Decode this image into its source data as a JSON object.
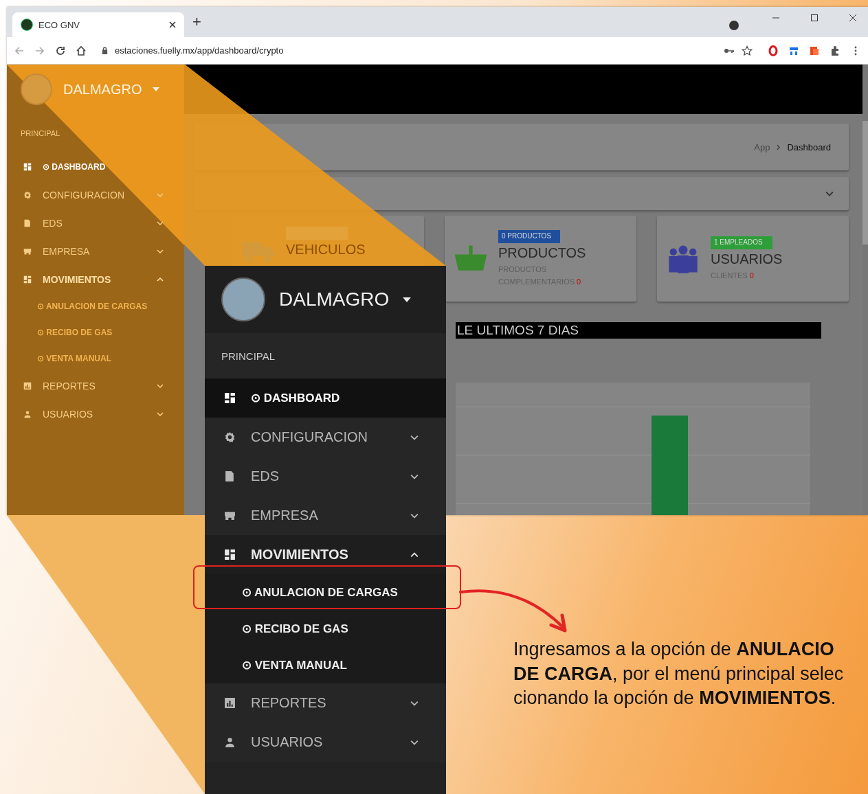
{
  "browser": {
    "tab_title": "ECO GNV",
    "new_tab": "+",
    "url": "estaciones.fuelly.mx/app/dashboard/crypto"
  },
  "background_sidebar": {
    "user": "DALMAGRO",
    "section": "PRINCIPAL",
    "items": [
      {
        "kind": "link",
        "prefix": "⊙",
        "label": "DASHBOARD",
        "selected": true
      },
      {
        "kind": "group",
        "label": "CONFIGURACION",
        "selected": false,
        "expanded": false
      },
      {
        "kind": "group",
        "label": "EDS",
        "selected": false,
        "expanded": false
      },
      {
        "kind": "group",
        "label": "EMPRESA",
        "selected": false,
        "expanded": false
      },
      {
        "kind": "group",
        "label": "MOVIMIENTOS",
        "selected": false,
        "expanded": true,
        "children": [
          {
            "prefix": "⊙",
            "label": "ANULACION DE CARGAS"
          },
          {
            "prefix": "⊙",
            "label": "RECIBO DE GAS"
          },
          {
            "prefix": "⊙",
            "label": "VENTA MANUAL"
          }
        ]
      },
      {
        "kind": "group",
        "label": "REPORTES",
        "selected": false,
        "expanded": false
      },
      {
        "kind": "group",
        "label": "USUARIOS",
        "selected": false,
        "expanded": false
      }
    ]
  },
  "breadcrumb": [
    "App",
    "Dashboard"
  ],
  "cards": [
    {
      "title": "VEHICULOS",
      "color": "#e3a23a"
    },
    {
      "badge": "0 PRODUCTOS",
      "color": "#1f4e9c",
      "title": "PRODUCTOS",
      "subtitle": "PRODUCTOS COMPLEMENTARIOS",
      "count": "0"
    },
    {
      "badge": "1 EMPLEADOS",
      "color": "#2e9e3a",
      "title": "USUARIOS",
      "subtitle": "CLIENTES",
      "count": "0"
    }
  ],
  "chart_title": "LE ULTIMOS 7 DIAS",
  "menu": {
    "user": "DALMAGRO",
    "section": "PRINCIPAL",
    "items": [
      {
        "kind": "link",
        "prefix": "⊙",
        "label": "DASHBOARD",
        "selected": true
      },
      {
        "kind": "group",
        "label": "CONFIGURACION",
        "selected": false,
        "expanded": false
      },
      {
        "kind": "group",
        "label": "EDS",
        "selected": false,
        "expanded": false
      },
      {
        "kind": "group",
        "label": "EMPRESA",
        "selected": false,
        "expanded": false
      },
      {
        "kind": "group",
        "label": "MOVIMIENTOS",
        "selected": false,
        "expanded": true,
        "children": [
          {
            "prefix": "⊙",
            "label": "ANULACION DE CARGAS"
          },
          {
            "prefix": "⊙",
            "label": "RECIBO DE GAS"
          },
          {
            "prefix": "⊙",
            "label": "VENTA MANUAL"
          }
        ]
      },
      {
        "kind": "group",
        "label": "REPORTES",
        "selected": false,
        "expanded": false
      },
      {
        "kind": "group",
        "label": "USUARIOS",
        "selected": false,
        "expanded": false
      }
    ]
  },
  "caption_lines": [
    "Ingresamos a la opción de **ANULACIO**",
    "**DE CARGA**, por el menú principal selec",
    "cionando la opción de **MOVIMIENTOS**."
  ]
}
